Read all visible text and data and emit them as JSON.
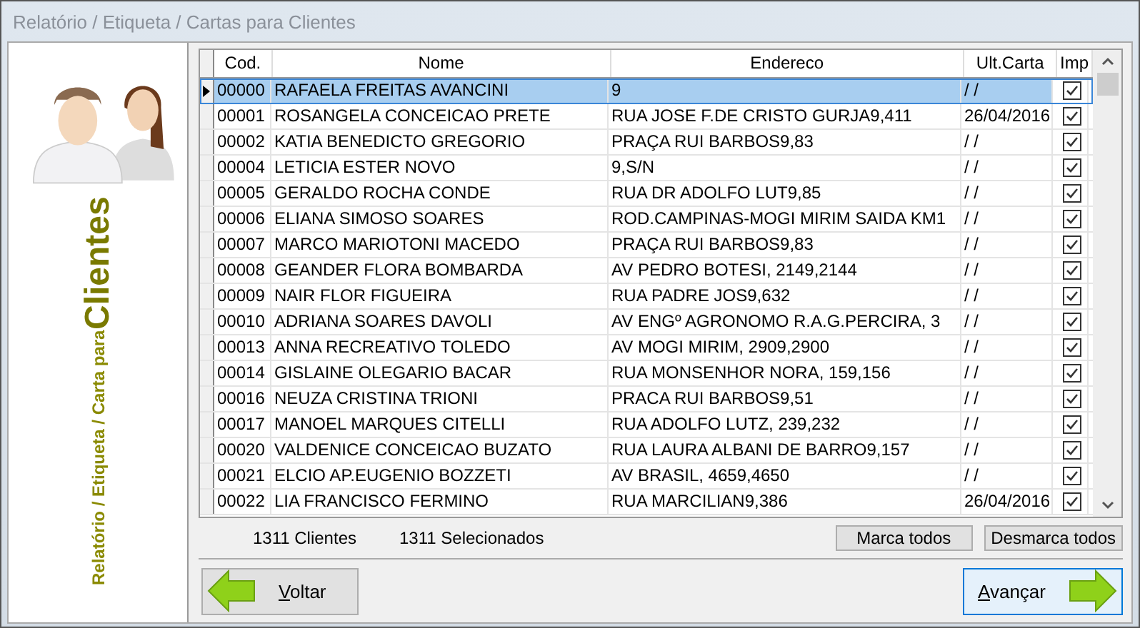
{
  "window": {
    "title": "Relatório / Etiqueta / Cartas para Clientes"
  },
  "side_panel": {
    "subtitle": "Relatório / Etiqueta / Carta para",
    "title": "Clientes"
  },
  "table": {
    "columns": [
      "Cod.",
      "Nome",
      "Endereco",
      "Ult.Carta",
      "Imp"
    ],
    "rows": [
      {
        "cod": "00000",
        "nome": "RAFAELA FREITAS AVANCINI",
        "endereco": "9",
        "ult_carta": "/ /",
        "imp": true,
        "selected": true
      },
      {
        "cod": "00001",
        "nome": "ROSANGELA CONCEICAO PRETE",
        "endereco": "RUA JOSE F.DE CRISTO GURJA9,411",
        "ult_carta": "26/04/2016",
        "imp": true,
        "selected": false
      },
      {
        "cod": "00002",
        "nome": "KATIA BENEDICTO GREGORIO",
        "endereco": "PRAÇA RUI BARBOS9,83",
        "ult_carta": "/ /",
        "imp": true,
        "selected": false
      },
      {
        "cod": "00004",
        "nome": "LETICIA ESTER NOVO",
        "endereco": "9,S/N",
        "ult_carta": "/ /",
        "imp": true,
        "selected": false
      },
      {
        "cod": "00005",
        "nome": "GERALDO ROCHA CONDE",
        "endereco": "RUA DR ADOLFO LUT9,85",
        "ult_carta": "/ /",
        "imp": true,
        "selected": false
      },
      {
        "cod": "00006",
        "nome": "ELIANA SIMOSO SOARES",
        "endereco": "ROD.CAMPINAS-MOGI MIRIM SAIDA KM1",
        "ult_carta": "/ /",
        "imp": true,
        "selected": false
      },
      {
        "cod": "00007",
        "nome": "MARCO MARIOTONI MACEDO",
        "endereco": "PRAÇA RUI BARBOS9,83",
        "ult_carta": "/ /",
        "imp": true,
        "selected": false
      },
      {
        "cod": "00008",
        "nome": "GEANDER FLORA BOMBARDA",
        "endereco": "AV PEDRO BOTESI, 2149,2144",
        "ult_carta": "/ /",
        "imp": true,
        "selected": false
      },
      {
        "cod": "00009",
        "nome": "NAIR FLOR FIGUEIRA",
        "endereco": "RUA PADRE JOS9,632",
        "ult_carta": "/ /",
        "imp": true,
        "selected": false
      },
      {
        "cod": "00010",
        "nome": "ADRIANA SOARES DAVOLI",
        "endereco": "AV ENGº AGRONOMO R.A.G.PERCIRA, 3",
        "ult_carta": "/ /",
        "imp": true,
        "selected": false
      },
      {
        "cod": "00013",
        "nome": "ANNA RECREATIVO TOLEDO",
        "endereco": "AV MOGI MIRIM, 2909,2900",
        "ult_carta": "/ /",
        "imp": true,
        "selected": false
      },
      {
        "cod": "00014",
        "nome": "GISLAINE OLEGARIO BACAR",
        "endereco": "RUA MONSENHOR NORA, 159,156",
        "ult_carta": "/ /",
        "imp": true,
        "selected": false
      },
      {
        "cod": "00016",
        "nome": "NEUZA CRISTINA TRIONI",
        "endereco": "PRACA RUI BARBOS9,51",
        "ult_carta": "/ /",
        "imp": true,
        "selected": false
      },
      {
        "cod": "00017",
        "nome": "MANOEL MARQUES CITELLI",
        "endereco": "RUA ADOLFO LUTZ, 239,232",
        "ult_carta": "/ /",
        "imp": true,
        "selected": false
      },
      {
        "cod": "00020",
        "nome": "VALDENICE CONCEICAO BUZATO",
        "endereco": "RUA LAURA ALBANI DE BARRO9,157",
        "ult_carta": "/ /",
        "imp": true,
        "selected": false
      },
      {
        "cod": "00021",
        "nome": "ELCIO AP.EUGENIO BOZZETI",
        "endereco": "AV BRASIL, 4659,4650",
        "ult_carta": "/ /",
        "imp": true,
        "selected": false
      },
      {
        "cod": "00022",
        "nome": "LIA FRANCISCO FERMINO",
        "endereco": "RUA MARCILIAN9,386",
        "ult_carta": "26/04/2016",
        "imp": true,
        "selected": false
      }
    ]
  },
  "status": {
    "clientes": "1311 Clientes",
    "selecionados": "1311 Selecionados"
  },
  "grid_buttons": [
    "Marca todos",
    "Desmarca todos"
  ],
  "nav_buttons": [
    {
      "label": "Voltar",
      "kind": "back"
    },
    {
      "label": "Avançar",
      "kind": "next"
    }
  ]
}
